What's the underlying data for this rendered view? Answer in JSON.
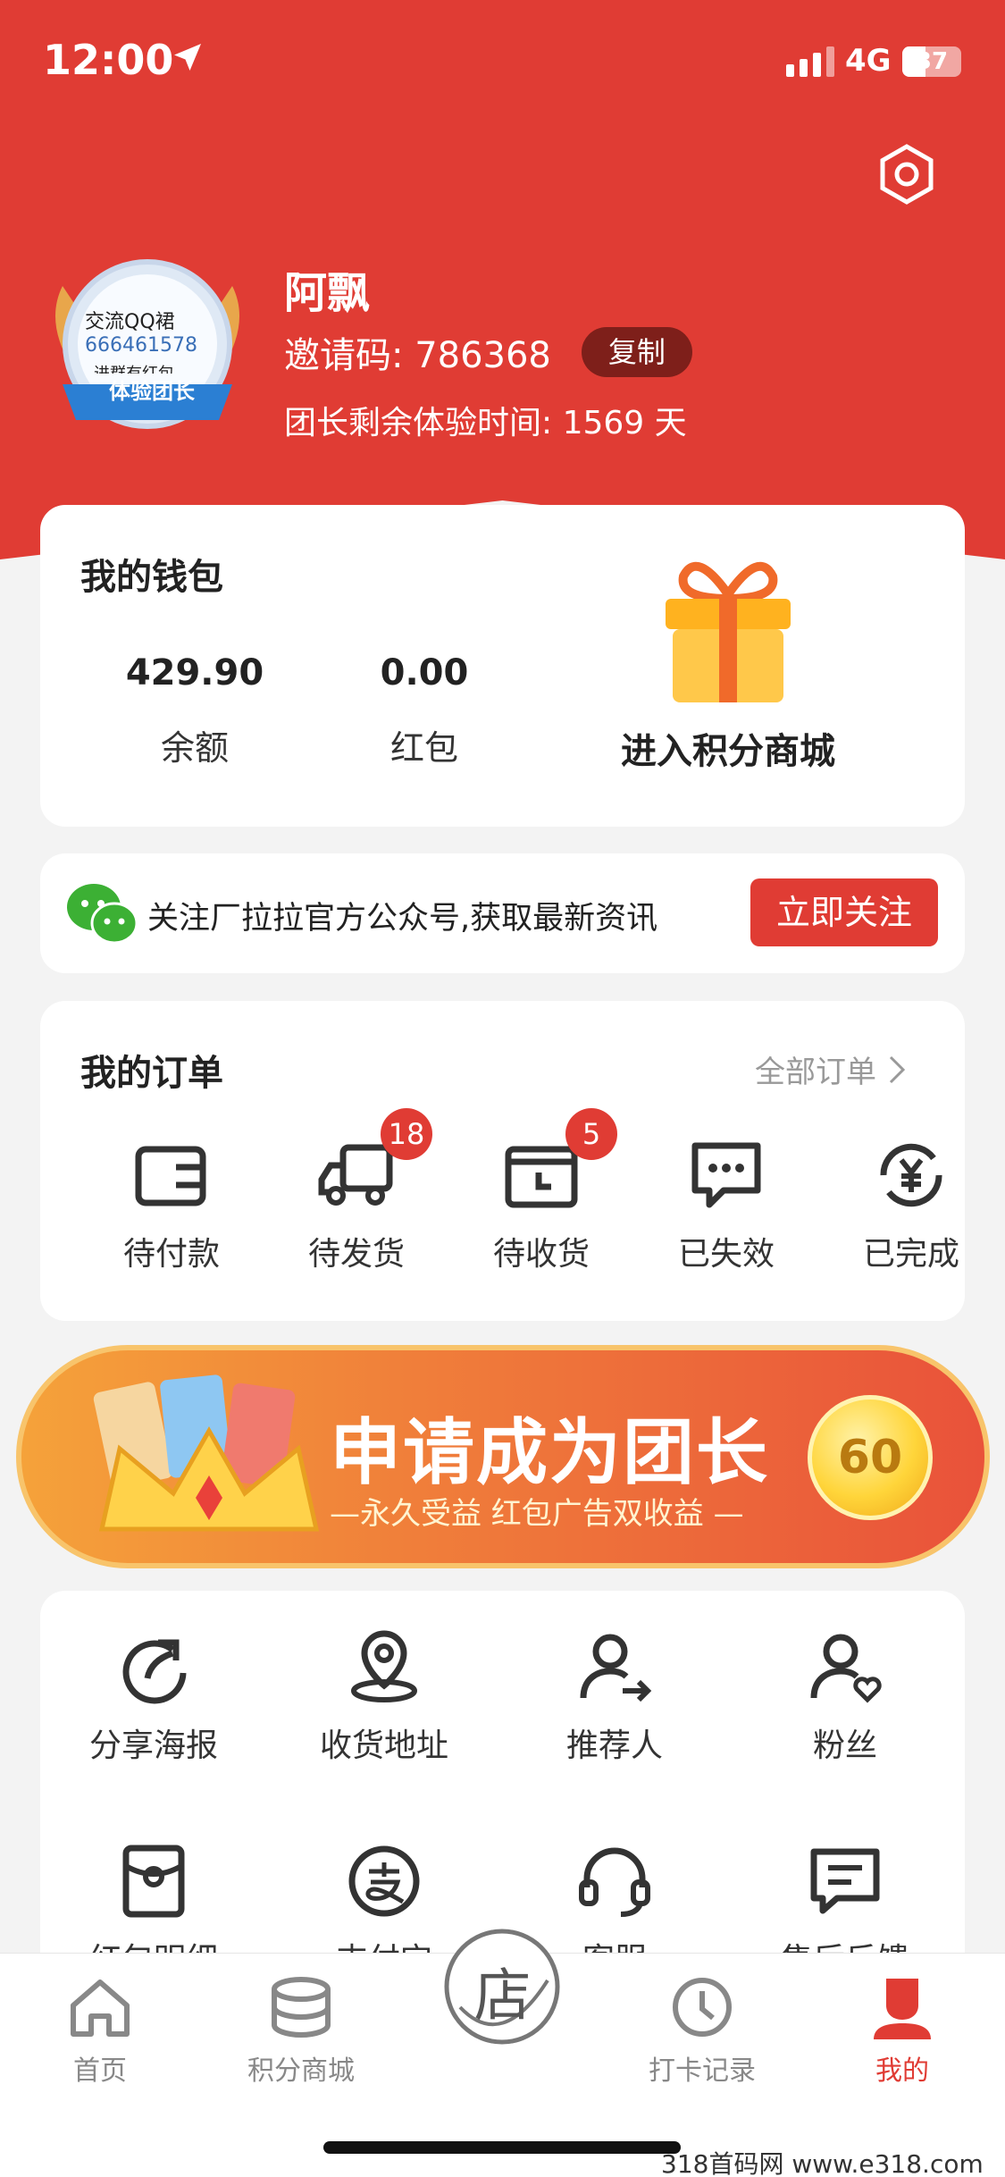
{
  "status_bar": {
    "time": "12:00",
    "network": "4G",
    "battery": "37"
  },
  "profile": {
    "badge_text": [
      "交流QQ裙",
      "666461578",
      "进群有红包"
    ],
    "badge_ribbon": "体验团长",
    "name": "阿飘",
    "invite_label": "邀请码: 786368",
    "copy_label": "复制",
    "trial_text": "团长剩余体验时间: 1569 天"
  },
  "wallet": {
    "title": "我的钱包",
    "balance_value": "429.90",
    "balance_label": "余额",
    "redpacket_value": "0.00",
    "redpacket_label": "红包",
    "mall_label": "进入积分商城"
  },
  "follow_bar": {
    "text": "关注厂拉拉官方公众号,获取最新资讯",
    "button": "立即关注"
  },
  "orders": {
    "title": "我的订单",
    "all_label": "全部订单",
    "items": [
      {
        "label": "待付款",
        "icon": "wallet-icon",
        "badge": ""
      },
      {
        "label": "待发货",
        "icon": "truck-icon",
        "badge": "18"
      },
      {
        "label": "待收货",
        "icon": "box-icon",
        "badge": "5"
      },
      {
        "label": "已失效",
        "icon": "message-icon",
        "badge": ""
      },
      {
        "label": "已完成",
        "icon": "yen-refresh-icon",
        "badge": ""
      }
    ]
  },
  "banner": {
    "headline": "申请成为团长",
    "subline": "—永久受益 红包广告双收益 —",
    "coin": "60"
  },
  "tools": [
    {
      "label": "分享海报",
      "icon": "share-icon"
    },
    {
      "label": "收货地址",
      "icon": "location-icon"
    },
    {
      "label": "推荐人",
      "icon": "referrer-icon"
    },
    {
      "label": "粉丝",
      "icon": "fans-icon"
    },
    {
      "label": "红包明细",
      "icon": "redpacket-icon"
    },
    {
      "label": "支付宝",
      "icon": "alipay-icon"
    },
    {
      "label": "客服",
      "icon": "headset-icon"
    },
    {
      "label": "售后反馈",
      "icon": "feedback-icon"
    }
  ],
  "tabbar": [
    {
      "label": "首页",
      "icon": "home-icon"
    },
    {
      "label": "积分商城",
      "icon": "coins-icon"
    },
    {
      "label": "店",
      "icon": "store-icon"
    },
    {
      "label": "打卡记录",
      "icon": "clock-icon"
    },
    {
      "label": "我的",
      "icon": "user-icon"
    }
  ],
  "watermark": "318首码网 www.e318.com",
  "colors": {
    "brand_red": "#e03c34",
    "dark_red": "#7e1f1a",
    "gold": "#f5a23a"
  }
}
